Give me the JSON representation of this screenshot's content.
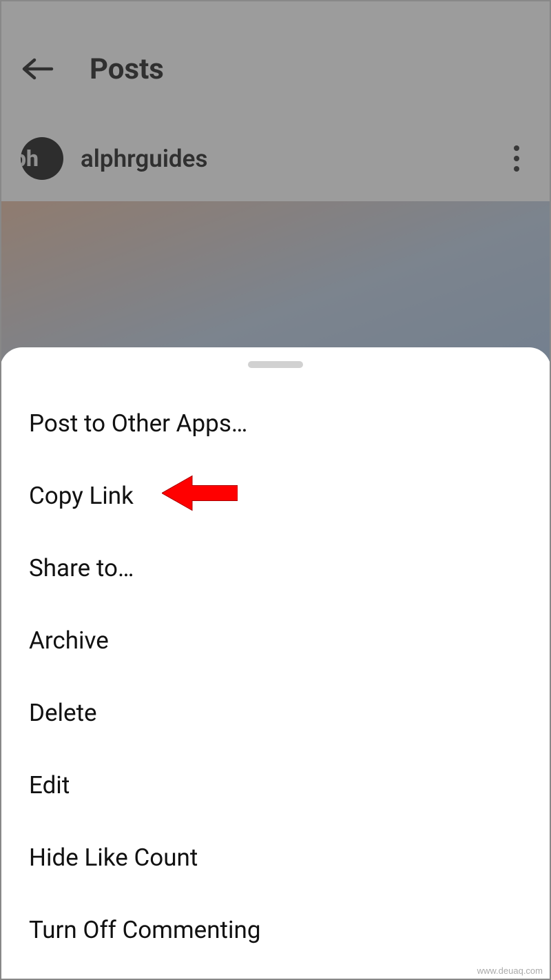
{
  "header": {
    "title": "Posts",
    "username": "alphrguides",
    "avatar_text": "ph"
  },
  "menu": {
    "items": [
      "Post to Other Apps…",
      "Copy Link",
      "Share to…",
      "Archive",
      "Delete",
      "Edit",
      "Hide Like Count",
      "Turn Off Commenting"
    ]
  },
  "annotation": {
    "highlighted_index": 1
  },
  "watermark": "www.deuaq.com"
}
